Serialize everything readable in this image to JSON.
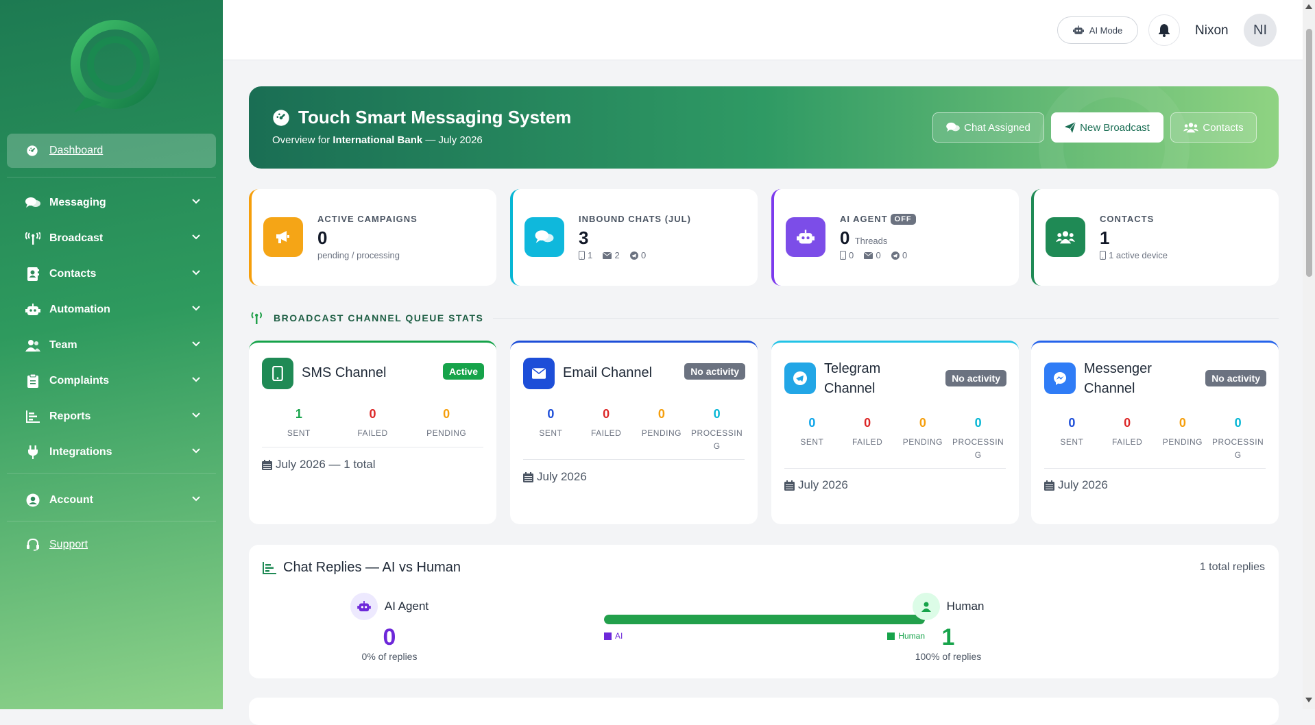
{
  "sidebar": {
    "dashboard_label": "Dashboard",
    "items": [
      {
        "label": "Messaging"
      },
      {
        "label": "Broadcast"
      },
      {
        "label": "Contacts"
      },
      {
        "label": "Automation"
      },
      {
        "label": "Team"
      },
      {
        "label": "Complaints"
      },
      {
        "label": "Reports"
      },
      {
        "label": "Integrations"
      }
    ],
    "account_label": "Account",
    "support_label": "Support"
  },
  "topbar": {
    "ai_mode_label": "AI Mode",
    "user_name": "Nixon",
    "avatar_initials": "NI"
  },
  "hero": {
    "title": "Touch Smart Messaging System",
    "subtitle_prefix": "Overview for",
    "org_name": "International Bank",
    "subtitle_suffix": "— July 2026",
    "buttons": {
      "chat_assigned": "Chat Assigned",
      "new_broadcast": "New Broadcast",
      "contacts": "Contacts"
    }
  },
  "stats": {
    "campaigns": {
      "title": "ACTIVE CAMPAIGNS",
      "value": "0",
      "sub": "pending / processing",
      "color": "#f59e0b"
    },
    "inbound": {
      "title": "INBOUND CHATS (JUL)",
      "value": "3",
      "sms": "1",
      "email": "2",
      "telegram": "0",
      "color": "#06b6d4"
    },
    "ai_agent": {
      "title": "AI AGENT",
      "badge": "OFF",
      "value": "0",
      "value_sub": "Threads",
      "sms": "0",
      "email": "0",
      "telegram": "0",
      "color": "#7c3aed"
    },
    "contacts": {
      "title": "CONTACTS",
      "value": "1",
      "sub": "1 active device",
      "color": "#1f8a55"
    }
  },
  "queue_section_title": "BROADCAST CHANNEL QUEUE STATS",
  "channels": {
    "sms": {
      "name": "SMS Channel",
      "badge": "Active",
      "badge_color": "#16a34a",
      "sent": "1",
      "failed": "0",
      "pending": "0",
      "labels": {
        "sent": "SENT",
        "failed": "FAILED",
        "pending": "PENDING"
      },
      "footer": "July 2026 — 1 total"
    },
    "email": {
      "name": "Email Channel",
      "badge": "No activity",
      "sent": "0",
      "failed": "0",
      "pending": "0",
      "processing": "0",
      "labels": {
        "sent": "SENT",
        "failed": "FAILED",
        "pending": "PENDING",
        "processing": "PROCESSING"
      },
      "footer": "July 2026"
    },
    "telegram": {
      "name_line1": "Telegram",
      "name_line2": "Channel",
      "badge": "No activity",
      "sent": "0",
      "failed": "0",
      "pending": "0",
      "processing": "0",
      "labels": {
        "sent": "SENT",
        "failed": "FAILED",
        "pending": "PENDING",
        "processing": "PROCESSING"
      },
      "footer": "July 2026"
    },
    "messenger": {
      "name_line1": "Messenger",
      "name_line2": "Channel",
      "badge": "No activity",
      "sent": "0",
      "failed": "0",
      "pending": "0",
      "processing": "0",
      "labels": {
        "sent": "SENT",
        "failed": "FAILED",
        "pending": "PENDING",
        "processing": "PROCESSING"
      },
      "footer": "July 2026"
    }
  },
  "replies": {
    "title": "Chat Replies — AI vs Human",
    "total": "1 total replies",
    "ai": {
      "label": "AI Agent",
      "value": "0",
      "pct": "0% of replies"
    },
    "human": {
      "label": "Human",
      "value": "1",
      "pct": "100% of replies"
    },
    "human_share": 1.0,
    "legend_ai": "AI",
    "legend_human": "Human"
  },
  "colors": {
    "accent_green": "#1f8a55",
    "sent_green": "#16a34a",
    "sent_blue": "#1d4ed8",
    "sent_cyan": "#0ea5e9",
    "failed": "#dc2626",
    "pending": "#f59e0b",
    "processing": "#06b6d4",
    "ai_purple": "#6d28d9",
    "human_green": "#22a04b"
  }
}
